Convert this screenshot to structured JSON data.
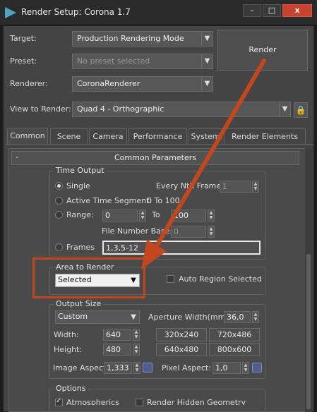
{
  "window": {
    "title": "Render Setup: Corona 1.7",
    "min": "–",
    "max": "□",
    "close": "x"
  },
  "target": {
    "label": "Target:",
    "value": "Production Rendering Mode"
  },
  "preset": {
    "label": "Preset:",
    "placeholder": "No preset selected"
  },
  "renderer": {
    "label": "Renderer:",
    "value": "CoronaRenderer"
  },
  "view": {
    "label": "View to Render:",
    "value": "Quad 4 - Orthographic"
  },
  "render_button": "Render",
  "tabs": [
    {
      "label": "Common"
    },
    {
      "label": "Scene"
    },
    {
      "label": "Camera"
    },
    {
      "label": "Performance"
    },
    {
      "label": "System"
    },
    {
      "label": "Render Elements"
    }
  ],
  "rollout": {
    "minus": "-",
    "title": "Common Parameters"
  },
  "time_output": {
    "title": "Time Output",
    "single": "Single",
    "every_nth_label": "Every Nth Frame:",
    "every_nth_value": "1",
    "active_segment": "Active Time Segment:",
    "active_segment_value": "0 To 100",
    "range": "Range:",
    "range_from": "0",
    "range_to_label": "To",
    "range_to": "100",
    "file_number_base_label": "File Number Base:",
    "file_number_base": "0",
    "frames": "Frames",
    "frames_value": "1,3,5-12"
  },
  "area": {
    "title": "Area to Render",
    "value": "Selected",
    "auto_region": "Auto Region Selected"
  },
  "output_size": {
    "title": "Output Size",
    "preset": "Custom",
    "aperture_label": "Aperture Width(mm):",
    "aperture": "36,0",
    "width_label": "Width:",
    "width": "640",
    "height_label": "Height:",
    "height": "480",
    "presets": [
      "320x240",
      "720x486",
      "640x480",
      "800x600"
    ],
    "image_aspect_label": "Image Aspect:",
    "image_aspect": "1,333",
    "pixel_aspect_label": "Pixel Aspect:",
    "pixel_aspect": "1,0"
  },
  "options": {
    "title": "Options",
    "atmospherics": "Atmospherics",
    "render_hidden": "Render Hidden Geometry"
  },
  "annotation": {
    "color": "#c2471f"
  }
}
